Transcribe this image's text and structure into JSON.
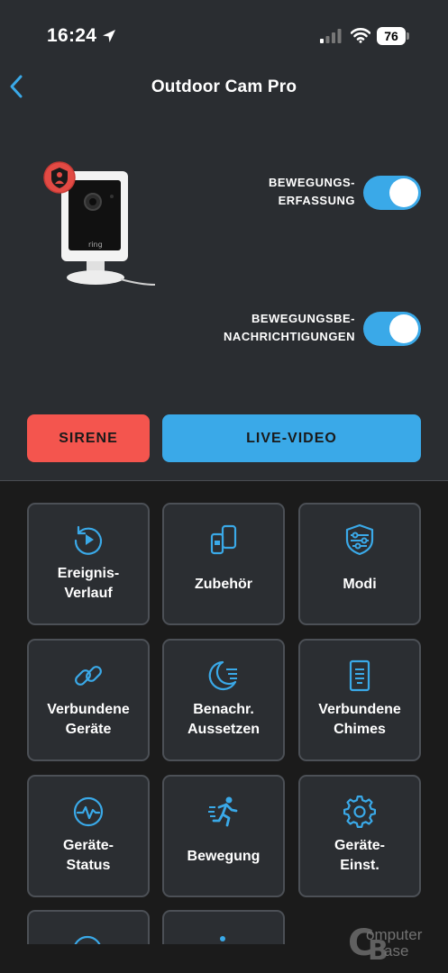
{
  "status_bar": {
    "time": "16:24",
    "battery": "76",
    "icons": [
      "location-arrow-icon",
      "cellular-signal-icon",
      "wifi-icon",
      "battery-icon"
    ]
  },
  "nav": {
    "title": "Outdoor Cam Pro",
    "back_icon": "chevron-left-icon"
  },
  "toggles": [
    {
      "label": "BEWEGUNGS-\nERFASSUNG",
      "on": true
    },
    {
      "label": "BEWEGUNGSBE-\nNACHRICHTIGUNGEN",
      "on": true
    }
  ],
  "actions": {
    "siren_label": "SIRENE",
    "live_label": "LIVE-VIDEO"
  },
  "tiles": [
    {
      "label": "Ereignis-\nVerlauf",
      "icon": "history-play-icon"
    },
    {
      "label": "Zubehör",
      "icon": "accessories-devices-icon"
    },
    {
      "label": "Modi",
      "icon": "shield-modes-icon"
    },
    {
      "label": "Verbundene\nGeräte",
      "icon": "link-chain-icon"
    },
    {
      "label": "Benachr.\nAussetzen",
      "icon": "snooze-moon-icon"
    },
    {
      "label": "Verbundene\nChimes",
      "icon": "chime-device-icon"
    },
    {
      "label": "Geräte-\nStatus",
      "icon": "device-health-icon"
    },
    {
      "label": "Bewegung",
      "icon": "motion-runner-icon"
    },
    {
      "label": "Geräte-\nEinst.",
      "icon": "settings-gear-icon"
    }
  ],
  "watermark": {
    "line1": "omputer",
    "line2": "ase"
  },
  "colors": {
    "accent_blue": "#3aa9e8",
    "siren_red": "#f4554e",
    "panel_top": "#2a2d31",
    "panel_bottom": "#1b1b1b",
    "tile_bg": "#2b2e32"
  }
}
